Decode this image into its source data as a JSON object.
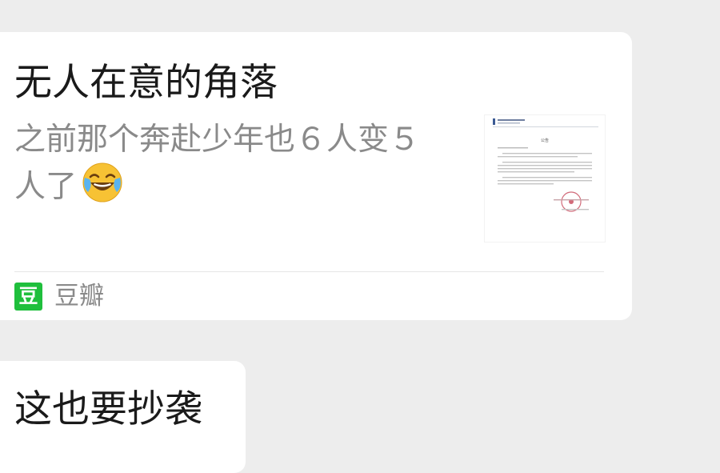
{
  "link_card": {
    "title": "无人在意的角落",
    "description": "之前那个奔赴少年也６人变５人了",
    "emoji": "face-with-tears-of-joy-icon",
    "thumbnail": {
      "heading": "公告"
    },
    "source": {
      "icon_glyph": "豆",
      "name": "豆瓣"
    },
    "colors": {
      "card_bg": "#ffffff",
      "title": "#1a1a1a",
      "description": "#8a8a8a",
      "source_icon_bg": "#1fbf3c"
    }
  },
  "message_bubble": {
    "text": "这也要抄袭"
  },
  "colors": {
    "chat_background": "#ededed"
  }
}
